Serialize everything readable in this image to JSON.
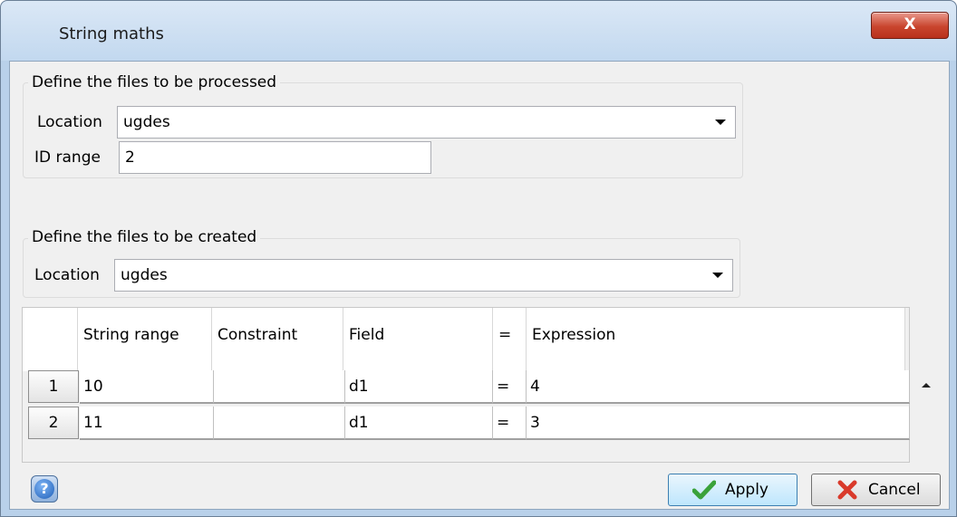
{
  "window": {
    "title": "String maths",
    "close_label": "X"
  },
  "processed": {
    "legend": "Define the files to be processed",
    "location_label": "Location",
    "location_value": "ugdes",
    "id_range_label": "ID range",
    "id_range_value": "2"
  },
  "created": {
    "legend": "Define the files to be created",
    "location_label": "Location",
    "location_value": "ugdes"
  },
  "grid": {
    "columns": [
      "String range",
      "Constraint",
      "Field",
      "=",
      "Expression"
    ],
    "rows": [
      {
        "num": "1",
        "string_range": "10",
        "constraint": "",
        "field": "d1",
        "eq": "=",
        "expression": "4"
      },
      {
        "num": "2",
        "string_range": "11",
        "constraint": "",
        "field": "d1",
        "eq": "=",
        "expression": "3"
      }
    ]
  },
  "buttons": {
    "help": "?",
    "apply": "Apply",
    "cancel": "Cancel"
  },
  "icons": {
    "help": "help-icon",
    "apply": "checkmark-icon",
    "cancel": "cross-icon",
    "scroll": "scroll-up-arrow-icon",
    "dropdown": "chevron-down-icon"
  },
  "colors": {
    "close_button": "#c9452e",
    "apply_border": "#3c7fb1",
    "check_green": "#3aa23a",
    "cross_red": "#d93a2b"
  }
}
